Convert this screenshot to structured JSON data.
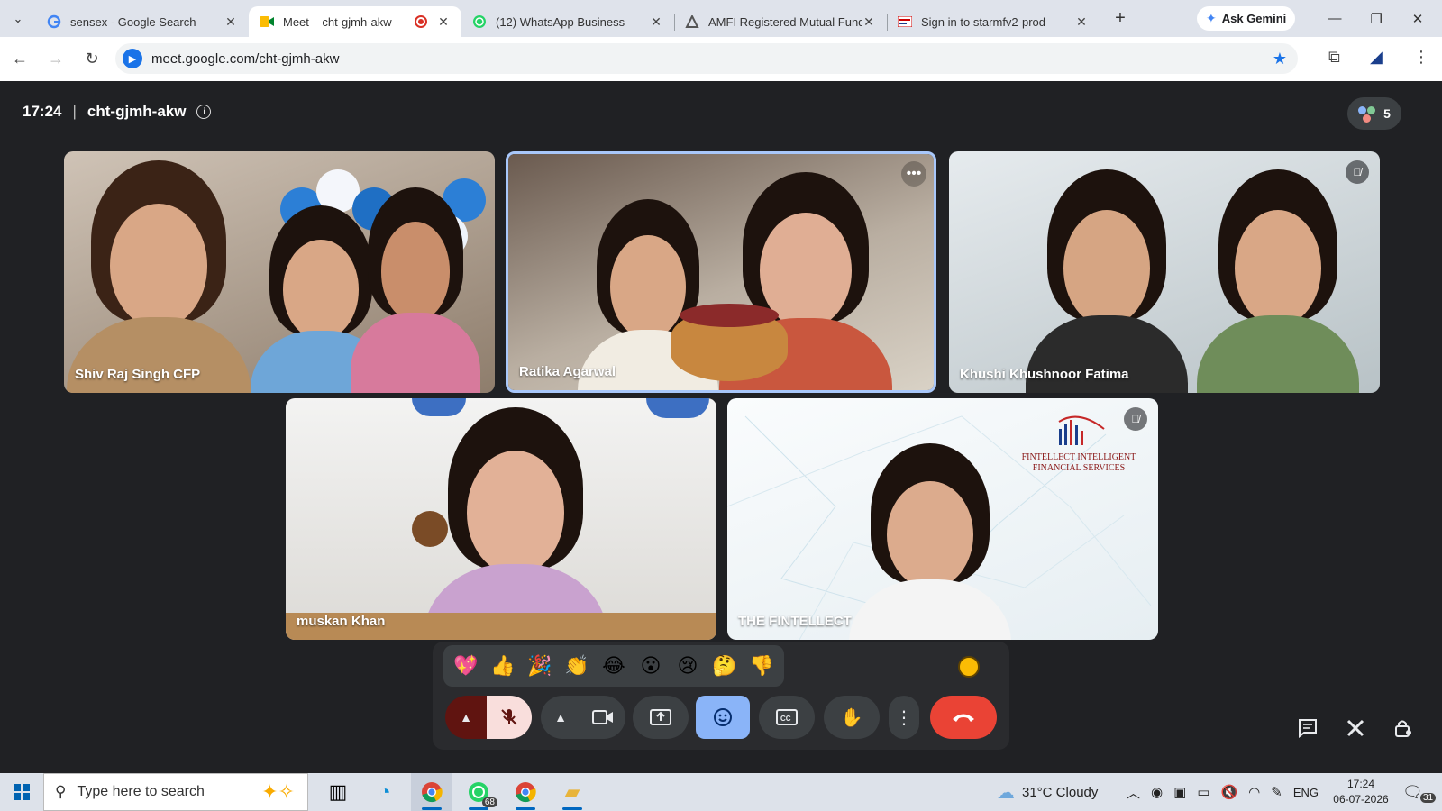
{
  "browser": {
    "tabs": [
      {
        "title": "sensex - Google Search",
        "icon": "google-icon",
        "active": false
      },
      {
        "title": "Meet – cht-gjmh-akw",
        "icon": "meet-icon",
        "active": true,
        "recording": true
      },
      {
        "title": "(12) WhatsApp Business",
        "icon": "whatsapp-icon",
        "active": false
      },
      {
        "title": "AMFI Registered Mutual Fund",
        "icon": "amfi-icon",
        "active": false
      },
      {
        "title": "Sign in to starmfv2-prod",
        "icon": "bse-icon",
        "active": false
      }
    ],
    "gemini_label": "Ask Gemini",
    "url": "meet.google.com/cht-gjmh-akw"
  },
  "meeting": {
    "time": "17:24",
    "code": "cht-gjmh-akw",
    "participant_count": "5",
    "participants": [
      {
        "name": "Shiv Raj Singh CFP",
        "muted": false,
        "speaking": false
      },
      {
        "name": "Ratika Agarwal",
        "muted": false,
        "speaking": true
      },
      {
        "name": "Khushi Khushnoor Fatima",
        "muted": true,
        "speaking": false
      },
      {
        "name": "muskan Khan",
        "muted": false,
        "speaking": false
      },
      {
        "name": "THE FINTELLECT",
        "muted": true,
        "speaking": false
      }
    ],
    "logo_text": "FINTELLECT INTELLIGENT FINANCIAL SERVICES",
    "reactions": [
      "💖",
      "👍",
      "🎉",
      "👏",
      "😂",
      "😮",
      "😢",
      "🤔",
      "👎"
    ]
  },
  "colors": {
    "meet_bg": "#202124",
    "end_call": "#ea4335",
    "mic_off": "#f9dedc",
    "active_control": "#8ab4f8",
    "speaking_border": "#a8c7fa"
  },
  "taskbar": {
    "search_placeholder": "Type here to search",
    "whatsapp_badge": "68",
    "weather": "31°C  Cloudy",
    "language": "ENG",
    "time": "17:24",
    "date": "06-07-2026",
    "notifications": "31"
  }
}
